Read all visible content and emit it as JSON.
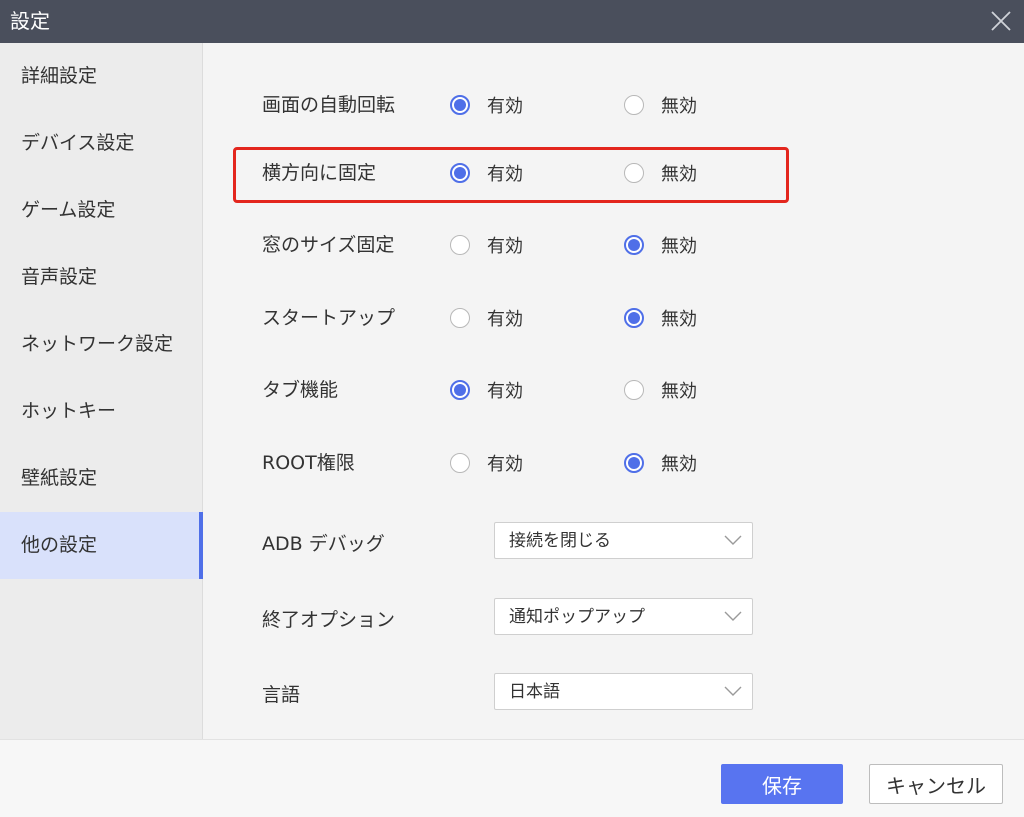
{
  "window": {
    "title": "設定",
    "close_icon": "close-icon"
  },
  "sidebar": {
    "items": [
      {
        "label": "詳細設定",
        "active": false
      },
      {
        "label": "デバイス設定",
        "active": false
      },
      {
        "label": "ゲーム設定",
        "active": false
      },
      {
        "label": "音声設定",
        "active": false
      },
      {
        "label": "ネットワーク設定",
        "active": false
      },
      {
        "label": "ホットキー",
        "active": false
      },
      {
        "label": "壁紙設定",
        "active": false
      },
      {
        "label": "他の設定",
        "active": true
      }
    ]
  },
  "settings": {
    "enable_label": "有効",
    "disable_label": "無効",
    "rows": [
      {
        "label": "画面の自動回転",
        "selected": "enable"
      },
      {
        "label": "横方向に固定",
        "selected": "enable",
        "highlighted": true
      },
      {
        "label": "窓のサイズ固定",
        "selected": "disable"
      },
      {
        "label": "スタートアップ",
        "selected": "disable"
      },
      {
        "label": "タブ機能",
        "selected": "enable"
      },
      {
        "label": "ROOT権限",
        "selected": "disable"
      }
    ],
    "dropdowns": [
      {
        "label": "ADB デバッグ",
        "value": "接続を閉じる"
      },
      {
        "label": "終了オプション",
        "value": "通知ポップアップ"
      },
      {
        "label": "言語",
        "value": "日本語"
      }
    ]
  },
  "footer": {
    "save_label": "保存",
    "cancel_label": "キャンセル"
  },
  "colors": {
    "accent": "#4f6fe8",
    "save_button": "#5874f0",
    "highlight_border": "#e3261d",
    "titlebar": "#4a4f5c"
  }
}
